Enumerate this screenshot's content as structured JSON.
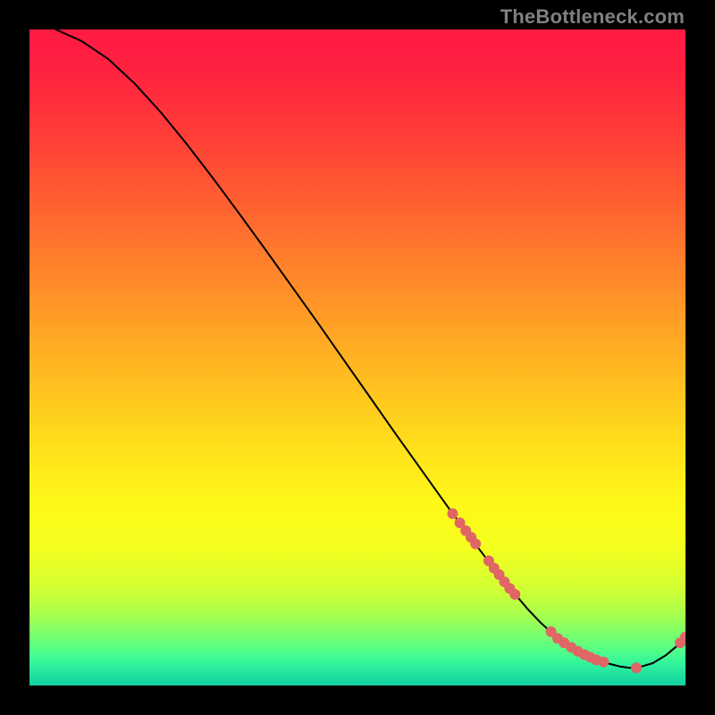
{
  "watermark": "TheBottleneck.com",
  "gradient": {
    "stops": [
      {
        "offset": 0.0,
        "color": "#ff1a43"
      },
      {
        "offset": 0.06,
        "color": "#ff2140"
      },
      {
        "offset": 0.15,
        "color": "#ff3a39"
      },
      {
        "offset": 0.25,
        "color": "#ff5b31"
      },
      {
        "offset": 0.35,
        "color": "#ff7e2c"
      },
      {
        "offset": 0.45,
        "color": "#ffa125"
      },
      {
        "offset": 0.55,
        "color": "#ffc31f"
      },
      {
        "offset": 0.65,
        "color": "#ffe41a"
      },
      {
        "offset": 0.72,
        "color": "#fff819"
      },
      {
        "offset": 0.79,
        "color": "#f4ff1e"
      },
      {
        "offset": 0.85,
        "color": "#d3ff32"
      },
      {
        "offset": 0.89,
        "color": "#aaff4b"
      },
      {
        "offset": 0.92,
        "color": "#7dff6a"
      },
      {
        "offset": 0.945,
        "color": "#54ff86"
      },
      {
        "offset": 0.965,
        "color": "#34f59a"
      },
      {
        "offset": 0.985,
        "color": "#1ee0a0"
      },
      {
        "offset": 1.0,
        "color": "#14cf9e"
      }
    ]
  },
  "chart_data": {
    "type": "line",
    "title": "",
    "xlabel": "",
    "ylabel": "",
    "xlim": [
      0,
      100
    ],
    "ylim": [
      0,
      100
    ],
    "curve": {
      "x": [
        4,
        8,
        12,
        16,
        20,
        24,
        28,
        32,
        36,
        40,
        44,
        48,
        52,
        56,
        60,
        64,
        68,
        72,
        76,
        78,
        80,
        82,
        84,
        86,
        88,
        90,
        91.5,
        93,
        95,
        97,
        99,
        100
      ],
      "y": [
        100,
        98.2,
        95.5,
        91.8,
        87.4,
        82.5,
        77.3,
        71.9,
        66.4,
        60.8,
        55.2,
        49.5,
        43.8,
        38.1,
        32.5,
        26.9,
        21.5,
        16.3,
        11.6,
        9.5,
        7.7,
        6.2,
        5.0,
        4.1,
        3.4,
        2.9,
        2.7,
        2.8,
        3.4,
        4.6,
        6.3,
        7.4
      ]
    },
    "points": [
      {
        "x": 64.5,
        "y": 26.2,
        "r": 6
      },
      {
        "x": 65.6,
        "y": 24.8,
        "r": 6
      },
      {
        "x": 66.5,
        "y": 23.6,
        "r": 6
      },
      {
        "x": 67.3,
        "y": 22.6,
        "r": 6
      },
      {
        "x": 68.0,
        "y": 21.6,
        "r": 6
      },
      {
        "x": 70.0,
        "y": 19.0,
        "r": 6
      },
      {
        "x": 70.8,
        "y": 17.9,
        "r": 6
      },
      {
        "x": 71.6,
        "y": 16.9,
        "r": 6
      },
      {
        "x": 72.4,
        "y": 15.8,
        "r": 6
      },
      {
        "x": 73.2,
        "y": 14.8,
        "r": 6
      },
      {
        "x": 74.0,
        "y": 13.9,
        "r": 6
      },
      {
        "x": 79.5,
        "y": 8.2,
        "r": 6
      },
      {
        "x": 80.5,
        "y": 7.2,
        "r": 6
      },
      {
        "x": 81.5,
        "y": 6.5,
        "r": 6
      },
      {
        "x": 82.6,
        "y": 5.8,
        "r": 6
      },
      {
        "x": 83.6,
        "y": 5.2,
        "r": 6
      },
      {
        "x": 84.6,
        "y": 4.7,
        "r": 6
      },
      {
        "x": 85.5,
        "y": 4.3,
        "r": 6
      },
      {
        "x": 86.4,
        "y": 3.9,
        "r": 6
      },
      {
        "x": 87.5,
        "y": 3.6,
        "r": 6
      },
      {
        "x": 92.5,
        "y": 2.7,
        "r": 6
      },
      {
        "x": 99.2,
        "y": 6.5,
        "r": 6
      },
      {
        "x": 100.0,
        "y": 7.4,
        "r": 6
      }
    ],
    "point_color": "#e06666",
    "line_color": "#000000"
  }
}
